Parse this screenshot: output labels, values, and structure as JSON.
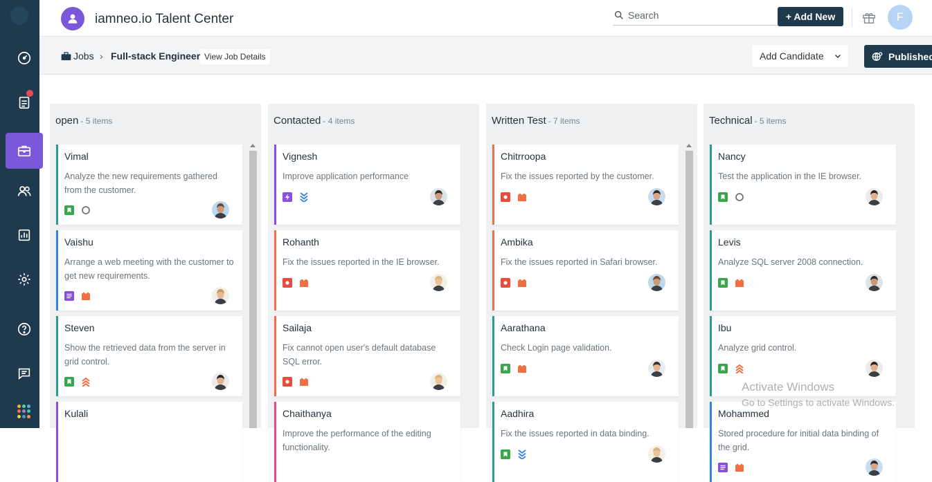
{
  "app": {
    "title": "iamneo.io Talent Center",
    "search_placeholder": "Search",
    "add_new_label": "+ Add New",
    "user_initial": "F"
  },
  "colors": {
    "sidebar": "#1e3a4c",
    "accent": "#7b57d9",
    "primary_button": "#1f3a4d",
    "green": "#3aa64b",
    "orange": "#f07043",
    "purple": "#8a4fe0",
    "blue": "#2e86de",
    "red": "#e74c3c"
  },
  "breadcrumb": {
    "jobs": "Jobs",
    "separator": "›",
    "job": "Full-stack Engineer",
    "view_details": "View Job Details"
  },
  "actions": {
    "add_candidate": "Add Candidate",
    "published": "Published"
  },
  "columns": [
    {
      "title": "open",
      "count": "- 5 items",
      "cards": [
        {
          "name": "Vimal",
          "desc": "Analyze the new requirements gathered from the customer.",
          "border": "#2a9d8f",
          "icons": [
            "green-flag-icon",
            "grey-circle-icon"
          ],
          "avatar": "avatar-f1"
        },
        {
          "name": "Vaishu",
          "desc": "Arrange a web meeting with the customer to get new requirements.",
          "border": "#2e86de",
          "icons": [
            "purple-doc-icon",
            "orange-bookmark-icon"
          ],
          "avatar": "avatar-f2"
        },
        {
          "name": "Steven",
          "desc": "Show the retrieved data from the server in grid control.",
          "border": "#2a9d8f",
          "icons": [
            "green-flag-icon",
            "orange-chevrons-icon"
          ],
          "avatar": "avatar-f3"
        },
        {
          "name": "Kulali",
          "desc": "",
          "border": "#8a4fe0",
          "icons": [],
          "avatar": ""
        }
      ]
    },
    {
      "title": "Contacted",
      "count": "- 4 items",
      "cards": [
        {
          "name": "Vignesh",
          "desc": "Improve application performance",
          "border": "#8a4fe0",
          "icons": [
            "purple-bolt-icon",
            "blue-chevrons-down-icon"
          ],
          "avatar": "avatar-m1"
        },
        {
          "name": "Rohanth",
          "desc": "Fix the issues reported in the IE browser.",
          "border": "#f07043",
          "icons": [
            "red-stop-icon",
            "orange-bookmark-icon"
          ],
          "avatar": "avatar-f4"
        },
        {
          "name": "Sailaja",
          "desc": "Fix cannot open user's default database SQL error.",
          "border": "#f07043",
          "icons": [
            "red-stop-icon",
            "orange-bookmark-icon"
          ],
          "avatar": "avatar-f4"
        },
        {
          "name": "Chaithanya",
          "desc": "Improve the performance of the editing functionality.",
          "border": "#e84b8a",
          "icons": [],
          "avatar": ""
        }
      ]
    },
    {
      "title": "Written Test",
      "count": "- 7 items",
      "cards": [
        {
          "name": "Chitrroopa",
          "desc": "Fix the issues reported by the customer.",
          "border": "#f07043",
          "icons": [
            "red-stop-icon",
            "orange-bookmark-icon"
          ],
          "avatar": "avatar-m2"
        },
        {
          "name": "Ambika",
          "desc": "Fix the issues reported in Safari browser.",
          "border": "#f07043",
          "icons": [
            "red-stop-icon",
            "orange-bookmark-icon"
          ],
          "avatar": "avatar-f1"
        },
        {
          "name": "Aarathana",
          "desc": "Check Login page validation.",
          "border": "#2a9d8f",
          "icons": [
            "green-flag-icon",
            "orange-bookmark-icon"
          ],
          "avatar": "avatar-m3"
        },
        {
          "name": "Aadhira",
          "desc": "Fix the issues reported in data binding.",
          "border": "#2a9d8f",
          "icons": [
            "green-flag-icon",
            "blue-chevrons-down-icon"
          ],
          "avatar": "avatar-f4"
        }
      ]
    },
    {
      "title": "Technical",
      "count": "- 5 items",
      "cards": [
        {
          "name": "Nancy",
          "desc": "Test the application in the IE browser.",
          "border": "#2a9d8f",
          "icons": [
            "green-flag-icon",
            "grey-circle-icon"
          ],
          "avatar": "avatar-f3"
        },
        {
          "name": "Levis",
          "desc": "Analyze SQL server 2008 connection.",
          "border": "#2a9d8f",
          "icons": [
            "green-flag-icon",
            "orange-bookmark-icon"
          ],
          "avatar": "avatar-m1"
        },
        {
          "name": "Ibu",
          "desc": "Analyze grid control.",
          "border": "#2a9d8f",
          "icons": [
            "green-flag-icon",
            "orange-chevrons-icon"
          ],
          "avatar": "avatar-f3"
        },
        {
          "name": "Mohammed",
          "desc": "Stored procedure for initial data binding of the grid.",
          "border": "#2e86de",
          "icons": [
            "purple-doc-icon",
            "orange-bookmark-icon"
          ],
          "avatar": "avatar-m2"
        }
      ]
    }
  ],
  "watermark": {
    "line1": "Activate Windows",
    "line2": "Go to Settings to activate Windows."
  }
}
